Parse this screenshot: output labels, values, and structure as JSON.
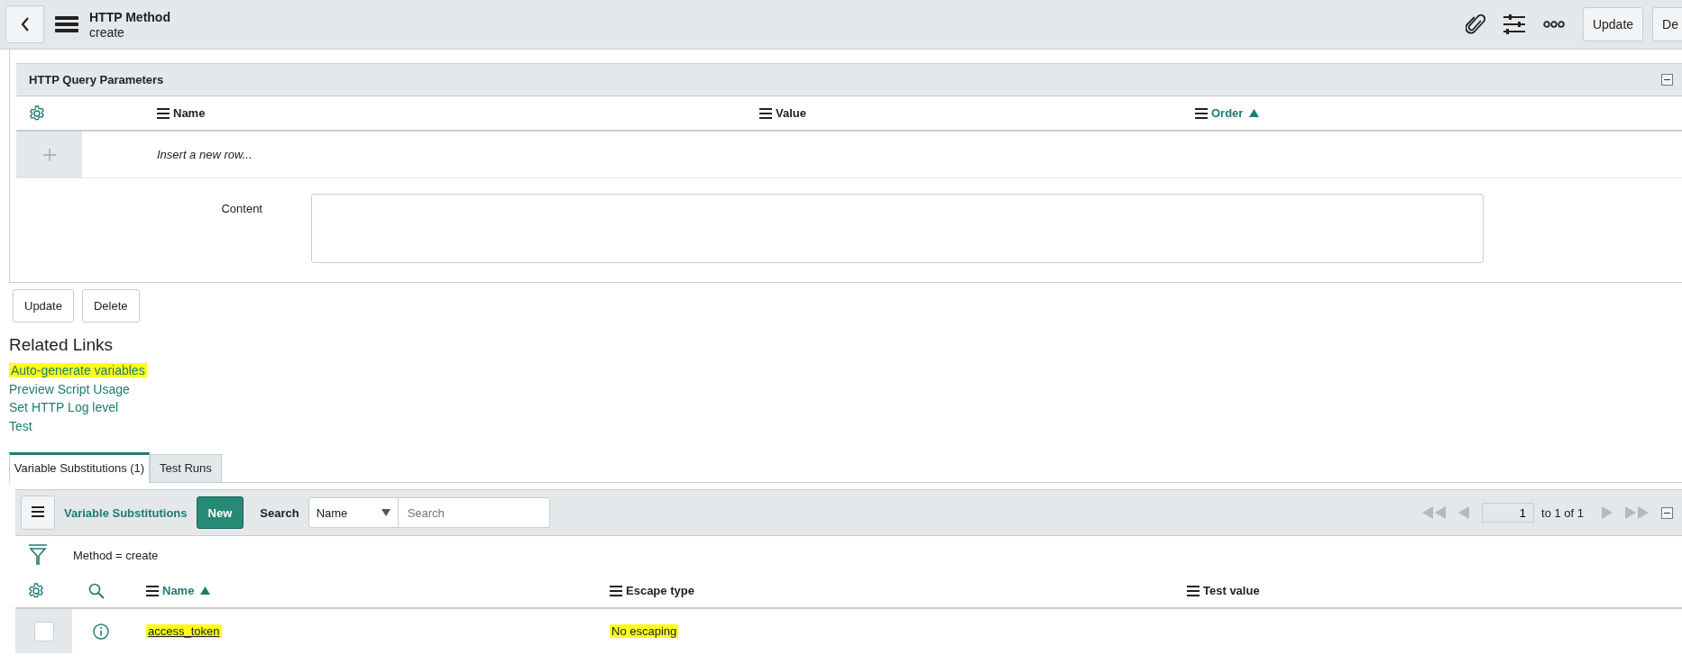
{
  "header": {
    "title": "HTTP Method",
    "subtitle": "create",
    "buttons": [
      "Update",
      "De"
    ]
  },
  "query_parameters": {
    "title": "HTTP Query Parameters",
    "columns": [
      {
        "label": "Name",
        "sorted": false
      },
      {
        "label": "Value",
        "sorted": false
      },
      {
        "label": "Order",
        "sorted": true
      }
    ],
    "insert_row": "Insert a new row..."
  },
  "content_field": {
    "label": "Content"
  },
  "form_buttons": [
    "Update",
    "Delete"
  ],
  "related_links": {
    "title": "Related Links",
    "links": [
      {
        "label": "Auto-generate variables",
        "highlighted": true
      },
      {
        "label": "Preview Script Usage",
        "highlighted": false
      },
      {
        "label": "Set HTTP Log level",
        "highlighted": false
      },
      {
        "label": "Test",
        "highlighted": false
      }
    ]
  },
  "tabs": [
    {
      "label": "Variable Substitutions (1)",
      "selected": true
    },
    {
      "label": "Test Runs",
      "selected": false
    }
  ],
  "list": {
    "title": "Variable Substitutions",
    "new_button": "New",
    "search_label": "Search",
    "search_column": "Name",
    "search": {
      "placeholder": "Search"
    },
    "page": "1",
    "range": "to 1 of 1",
    "filter": "Method = create",
    "columns": [
      {
        "label": "Name",
        "sorted": true
      },
      {
        "label": "Escape type",
        "sorted": false
      },
      {
        "label": "Test value",
        "sorted": false
      }
    ],
    "rows": [
      {
        "checked": false,
        "cells": [
          {
            "kind": "link",
            "text": "access_token",
            "highlighted": true
          },
          {
            "kind": "text",
            "text": "No escaping",
            "highlighted": true
          }
        ]
      }
    ]
  }
}
